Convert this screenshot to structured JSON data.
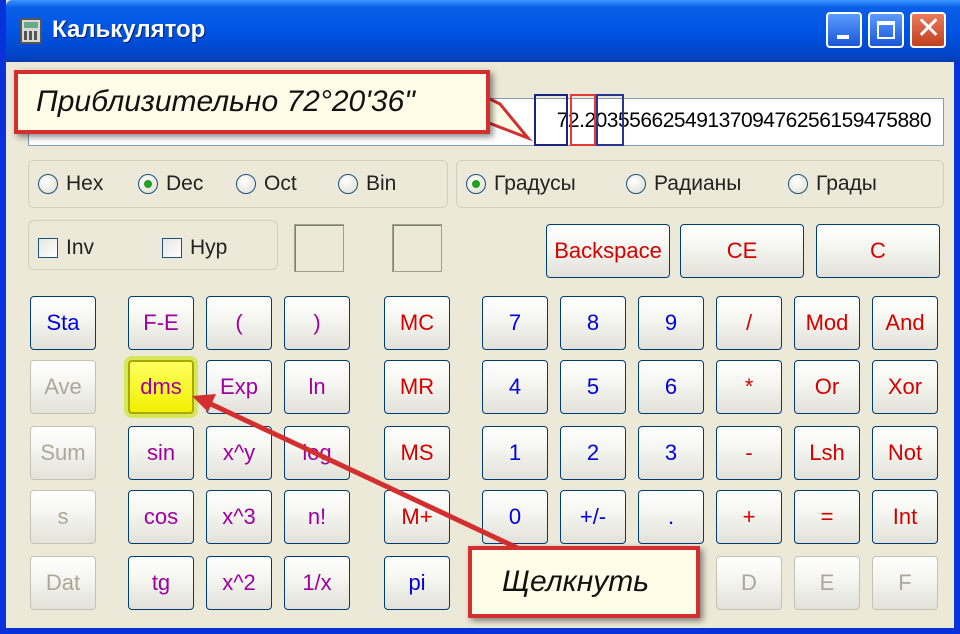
{
  "window": {
    "title": "Калькулятор"
  },
  "display": {
    "value": "72.2035566254913709476256159475880"
  },
  "base_options": [
    {
      "label": "Hex",
      "checked": false
    },
    {
      "label": "Dec",
      "checked": true
    },
    {
      "label": "Oct",
      "checked": false
    },
    {
      "label": "Bin",
      "checked": false
    }
  ],
  "angle_options": [
    {
      "label": "Градусы",
      "checked": true
    },
    {
      "label": "Радианы",
      "checked": false
    },
    {
      "label": "Грады",
      "checked": false
    }
  ],
  "checkboxes": {
    "inv": "Inv",
    "hyp": "Hyp"
  },
  "top_buttons": {
    "backspace": "Backspace",
    "ce": "CE",
    "c": "C"
  },
  "keys": {
    "sta": "Sta",
    "ave": "Ave",
    "sum": "Sum",
    "s": "s",
    "dat": "Dat",
    "fe": "F-E",
    "dms": "dms",
    "sin": "sin",
    "cos": "cos",
    "tg": "tg",
    "lparen": "(",
    "exp": "Exp",
    "xy": "x^y",
    "x3": "x^3",
    "x2": "x^2",
    "rparen": ")",
    "ln": "ln",
    "log": "log",
    "nfact": "n!",
    "inv": "1/x",
    "mc": "MC",
    "mr": "MR",
    "ms": "MS",
    "mplus": "M+",
    "pi": "pi",
    "d7": "7",
    "d8": "8",
    "d9": "9",
    "div": "/",
    "mod": "Mod",
    "and": "And",
    "d4": "4",
    "d5": "5",
    "d6": "6",
    "mul": "*",
    "or": "Or",
    "xor": "Xor",
    "d1": "1",
    "d2": "2",
    "d3": "3",
    "sub": "-",
    "lsh": "Lsh",
    "not": "Not",
    "d0": "0",
    "sign": "+/-",
    "dot": ".",
    "add": "+",
    "eq": "=",
    "int": "Int",
    "hexD": "D",
    "hexE": "E",
    "hexF": "F"
  },
  "annotations": {
    "approx": "Приблизительно 72°20'36\"",
    "click": "Щелкнуть"
  },
  "colors": {
    "annotation_border": "#d32f2f",
    "highlight": "#ffff00",
    "titlebar": "#0054e3"
  }
}
